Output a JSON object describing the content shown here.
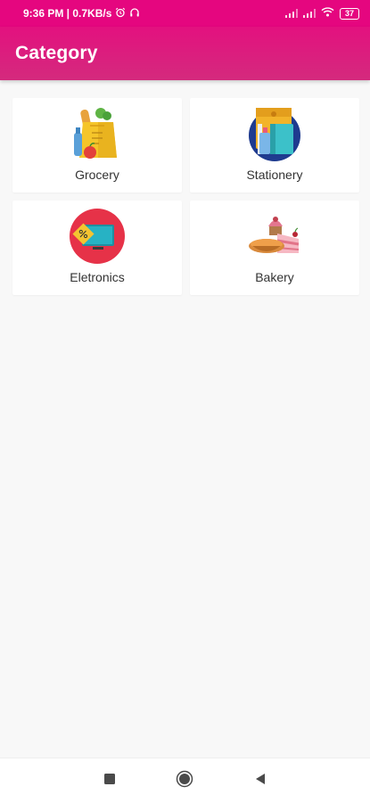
{
  "status_bar": {
    "time_speed": "9:36 PM | 0.7KB/s",
    "battery": "37"
  },
  "app_bar": {
    "title": "Category"
  },
  "categories": [
    {
      "label": "Grocery",
      "icon": "grocery-bag-icon"
    },
    {
      "label": "Stationery",
      "icon": "stationery-icon"
    },
    {
      "label": "Eletronics",
      "icon": "electronics-tv-icon"
    },
    {
      "label": "Bakery",
      "icon": "bakery-cake-icon"
    }
  ],
  "navigation": {
    "buttons": [
      "recent-apps",
      "home",
      "back"
    ]
  },
  "colors": {
    "primary": "#e5067f",
    "app_bar_gradient_end": "#d42a7d",
    "background": "#f8f8f8"
  }
}
